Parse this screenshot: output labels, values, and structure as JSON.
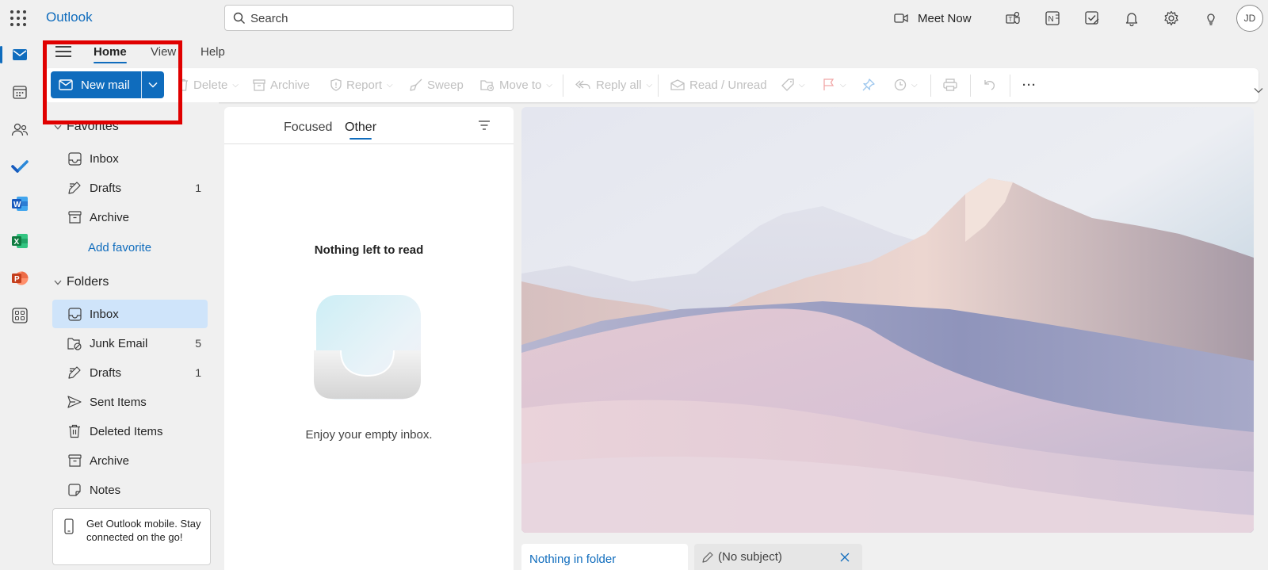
{
  "app": {
    "name": "Outlook"
  },
  "search": {
    "placeholder": "Search"
  },
  "topbar": {
    "meet_now": "Meet Now",
    "avatar_initials": "JD"
  },
  "ribbon": {
    "tabs": [
      {
        "label": "Home",
        "active": true
      },
      {
        "label": "View"
      },
      {
        "label": "Help"
      }
    ],
    "new_mail": "New mail",
    "actions": {
      "delete": "Delete",
      "archive": "Archive",
      "report": "Report",
      "sweep": "Sweep",
      "move_to": "Move to",
      "reply_all": "Reply all",
      "read_unread": "Read / Unread",
      "more": "···"
    }
  },
  "folders": {
    "favorites_label": "Favorites",
    "favorites": [
      {
        "label": "Inbox",
        "count": ""
      },
      {
        "label": "Drafts",
        "count": "1"
      },
      {
        "label": "Archive",
        "count": ""
      }
    ],
    "add_favorite": "Add favorite",
    "folders_label": "Folders",
    "items": [
      {
        "label": "Inbox",
        "count": "",
        "selected": true
      },
      {
        "label": "Junk Email",
        "count": "5"
      },
      {
        "label": "Drafts",
        "count": "1"
      },
      {
        "label": "Sent Items",
        "count": ""
      },
      {
        "label": "Deleted Items",
        "count": ""
      },
      {
        "label": "Archive",
        "count": ""
      },
      {
        "label": "Notes",
        "count": ""
      }
    ],
    "promo": "Get Outlook mobile. Stay connected on the go!"
  },
  "message_list": {
    "tabs": [
      {
        "label": "Focused"
      },
      {
        "label": "Other",
        "active": true
      }
    ],
    "empty_title": "Nothing left to read",
    "empty_subtitle": "Enjoy your empty inbox."
  },
  "bottom_tabs": {
    "nothing_in_folder": "Nothing in folder",
    "draft": "(No subject)"
  },
  "colors": {
    "accent": "#0f6cbd",
    "highlight": "#e00000",
    "selected": "#cfe4fa"
  }
}
